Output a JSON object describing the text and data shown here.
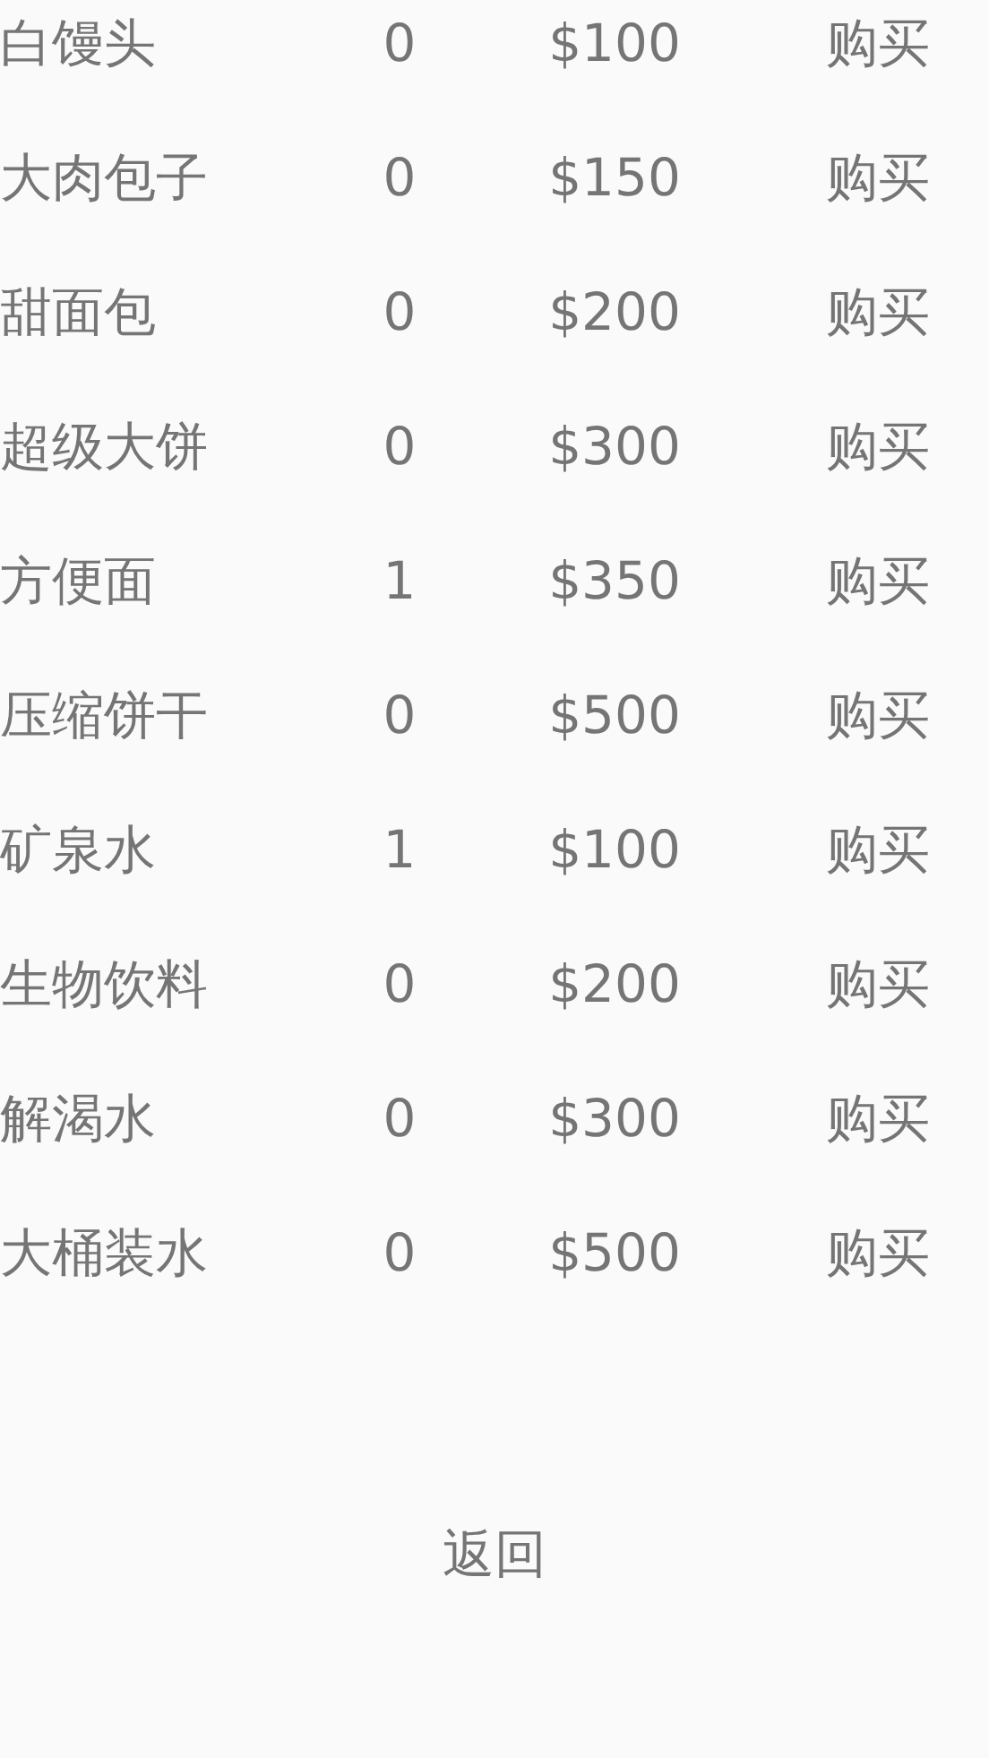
{
  "items": [
    {
      "name": "白馒头",
      "count": "0",
      "price": "$100",
      "buy": "购买"
    },
    {
      "name": "大肉包子",
      "count": "0",
      "price": "$150",
      "buy": "购买"
    },
    {
      "name": "甜面包",
      "count": "0",
      "price": "$200",
      "buy": "购买"
    },
    {
      "name": "超级大饼",
      "count": "0",
      "price": "$300",
      "buy": "购买"
    },
    {
      "name": "方便面",
      "count": "1",
      "price": "$350",
      "buy": "购买"
    },
    {
      "name": "压缩饼干",
      "count": "0",
      "price": "$500",
      "buy": "购买"
    },
    {
      "name": "矿泉水",
      "count": "1",
      "price": "$100",
      "buy": "购买"
    },
    {
      "name": "生物饮料",
      "count": "0",
      "price": "$200",
      "buy": "购买"
    },
    {
      "name": "解渴水",
      "count": "0",
      "price": "$300",
      "buy": "购买"
    },
    {
      "name": "大桶装水",
      "count": "0",
      "price": "$500",
      "buy": "购买"
    }
  ],
  "back_button": "返回"
}
